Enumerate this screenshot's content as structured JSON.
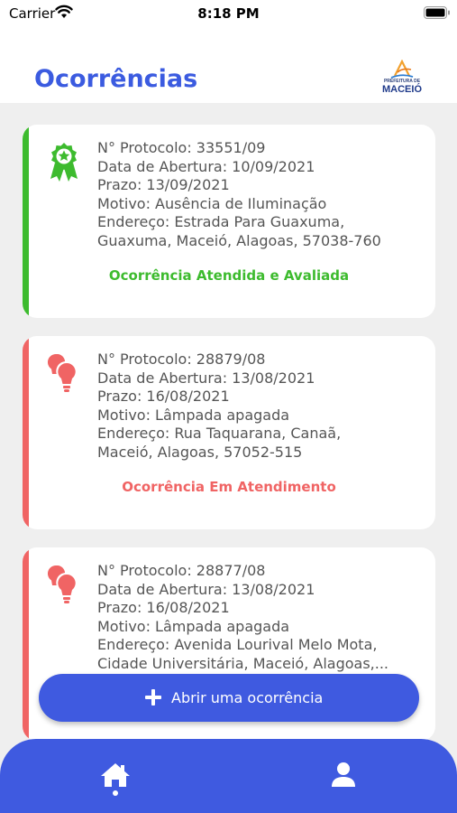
{
  "status_bar": {
    "carrier": "Carrier",
    "time": "8:18 PM"
  },
  "header": {
    "title": "Ocorrências",
    "logo_line1": "PREFEITURA DE",
    "logo_line2": "MACEIÓ"
  },
  "colors": {
    "primary": "#3f5ae0",
    "success": "#3dbb2e",
    "warning": "#f06464"
  },
  "occurrences": [
    {
      "icon": "award-icon",
      "protocol": "N° Protocolo: 33551/09",
      "opened": "Data de Abertura: 10/09/2021",
      "deadline": "Prazo: 13/09/2021",
      "reason": "Motivo: Ausência de Iluminação",
      "address_line1": "Endereço: Estrada Para Guaxuma,",
      "address_line2": "Guaxuma, Maceió, Alagoas, 57038-760",
      "status": "Ocorrência Atendida e Avaliada"
    },
    {
      "icon": "lightbulbs-icon",
      "protocol": "N° Protocolo: 28879/08",
      "opened": "Data de Abertura: 13/08/2021",
      "deadline": "Prazo: 16/08/2021",
      "reason": "Motivo: Lâmpada apagada",
      "address_line1": "Endereço: Rua Taquarana, Canaã,",
      "address_line2": "Maceió, Alagoas, 57052-515",
      "status": "Ocorrência Em Atendimento"
    },
    {
      "icon": "lightbulbs-icon",
      "protocol": "N° Protocolo: 28877/08",
      "opened": "Data de Abertura: 13/08/2021",
      "deadline": "Prazo: 16/08/2021",
      "reason": "Motivo: Lâmpada apagada",
      "address_line1": "Endereço: Avenida Lourival Melo Mota,",
      "address_line2": "Cidade Universitária, Maceió, Alagoas,..."
    }
  ],
  "fab": {
    "label": "Abrir uma ocorrência",
    "icon": "plus-icon"
  },
  "bottom_nav": {
    "items": [
      {
        "icon": "home-icon"
      },
      {
        "icon": "user-icon"
      }
    ]
  }
}
